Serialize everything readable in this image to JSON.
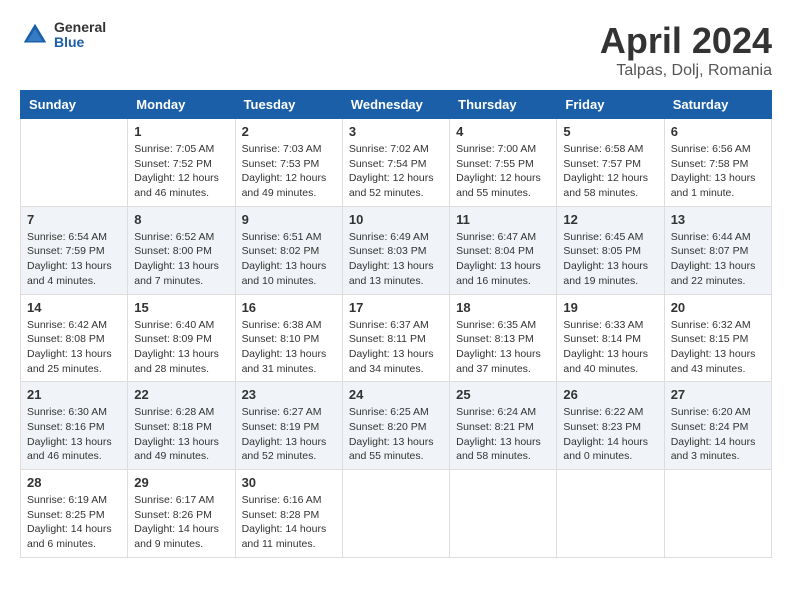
{
  "header": {
    "logo_general": "General",
    "logo_blue": "Blue",
    "month_title": "April 2024",
    "location": "Talpas, Dolj, Romania"
  },
  "days_of_week": [
    "Sunday",
    "Monday",
    "Tuesday",
    "Wednesday",
    "Thursday",
    "Friday",
    "Saturday"
  ],
  "weeks": [
    [
      {
        "day": "",
        "detail": ""
      },
      {
        "day": "1",
        "detail": "Sunrise: 7:05 AM\nSunset: 7:52 PM\nDaylight: 12 hours\nand 46 minutes."
      },
      {
        "day": "2",
        "detail": "Sunrise: 7:03 AM\nSunset: 7:53 PM\nDaylight: 12 hours\nand 49 minutes."
      },
      {
        "day": "3",
        "detail": "Sunrise: 7:02 AM\nSunset: 7:54 PM\nDaylight: 12 hours\nand 52 minutes."
      },
      {
        "day": "4",
        "detail": "Sunrise: 7:00 AM\nSunset: 7:55 PM\nDaylight: 12 hours\nand 55 minutes."
      },
      {
        "day": "5",
        "detail": "Sunrise: 6:58 AM\nSunset: 7:57 PM\nDaylight: 12 hours\nand 58 minutes."
      },
      {
        "day": "6",
        "detail": "Sunrise: 6:56 AM\nSunset: 7:58 PM\nDaylight: 13 hours\nand 1 minute."
      }
    ],
    [
      {
        "day": "7",
        "detail": "Sunrise: 6:54 AM\nSunset: 7:59 PM\nDaylight: 13 hours\nand 4 minutes."
      },
      {
        "day": "8",
        "detail": "Sunrise: 6:52 AM\nSunset: 8:00 PM\nDaylight: 13 hours\nand 7 minutes."
      },
      {
        "day": "9",
        "detail": "Sunrise: 6:51 AM\nSunset: 8:02 PM\nDaylight: 13 hours\nand 10 minutes."
      },
      {
        "day": "10",
        "detail": "Sunrise: 6:49 AM\nSunset: 8:03 PM\nDaylight: 13 hours\nand 13 minutes."
      },
      {
        "day": "11",
        "detail": "Sunrise: 6:47 AM\nSunset: 8:04 PM\nDaylight: 13 hours\nand 16 minutes."
      },
      {
        "day": "12",
        "detail": "Sunrise: 6:45 AM\nSunset: 8:05 PM\nDaylight: 13 hours\nand 19 minutes."
      },
      {
        "day": "13",
        "detail": "Sunrise: 6:44 AM\nSunset: 8:07 PM\nDaylight: 13 hours\nand 22 minutes."
      }
    ],
    [
      {
        "day": "14",
        "detail": "Sunrise: 6:42 AM\nSunset: 8:08 PM\nDaylight: 13 hours\nand 25 minutes."
      },
      {
        "day": "15",
        "detail": "Sunrise: 6:40 AM\nSunset: 8:09 PM\nDaylight: 13 hours\nand 28 minutes."
      },
      {
        "day": "16",
        "detail": "Sunrise: 6:38 AM\nSunset: 8:10 PM\nDaylight: 13 hours\nand 31 minutes."
      },
      {
        "day": "17",
        "detail": "Sunrise: 6:37 AM\nSunset: 8:11 PM\nDaylight: 13 hours\nand 34 minutes."
      },
      {
        "day": "18",
        "detail": "Sunrise: 6:35 AM\nSunset: 8:13 PM\nDaylight: 13 hours\nand 37 minutes."
      },
      {
        "day": "19",
        "detail": "Sunrise: 6:33 AM\nSunset: 8:14 PM\nDaylight: 13 hours\nand 40 minutes."
      },
      {
        "day": "20",
        "detail": "Sunrise: 6:32 AM\nSunset: 8:15 PM\nDaylight: 13 hours\nand 43 minutes."
      }
    ],
    [
      {
        "day": "21",
        "detail": "Sunrise: 6:30 AM\nSunset: 8:16 PM\nDaylight: 13 hours\nand 46 minutes."
      },
      {
        "day": "22",
        "detail": "Sunrise: 6:28 AM\nSunset: 8:18 PM\nDaylight: 13 hours\nand 49 minutes."
      },
      {
        "day": "23",
        "detail": "Sunrise: 6:27 AM\nSunset: 8:19 PM\nDaylight: 13 hours\nand 52 minutes."
      },
      {
        "day": "24",
        "detail": "Sunrise: 6:25 AM\nSunset: 8:20 PM\nDaylight: 13 hours\nand 55 minutes."
      },
      {
        "day": "25",
        "detail": "Sunrise: 6:24 AM\nSunset: 8:21 PM\nDaylight: 13 hours\nand 58 minutes."
      },
      {
        "day": "26",
        "detail": "Sunrise: 6:22 AM\nSunset: 8:23 PM\nDaylight: 14 hours\nand 0 minutes."
      },
      {
        "day": "27",
        "detail": "Sunrise: 6:20 AM\nSunset: 8:24 PM\nDaylight: 14 hours\nand 3 minutes."
      }
    ],
    [
      {
        "day": "28",
        "detail": "Sunrise: 6:19 AM\nSunset: 8:25 PM\nDaylight: 14 hours\nand 6 minutes."
      },
      {
        "day": "29",
        "detail": "Sunrise: 6:17 AM\nSunset: 8:26 PM\nDaylight: 14 hours\nand 9 minutes."
      },
      {
        "day": "30",
        "detail": "Sunrise: 6:16 AM\nSunset: 8:28 PM\nDaylight: 14 hours\nand 11 minutes."
      },
      {
        "day": "",
        "detail": ""
      },
      {
        "day": "",
        "detail": ""
      },
      {
        "day": "",
        "detail": ""
      },
      {
        "day": "",
        "detail": ""
      }
    ]
  ]
}
